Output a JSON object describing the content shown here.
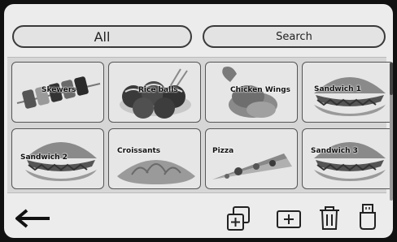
{
  "filter": {
    "all_label": "All",
    "search_label": "Search"
  },
  "items": [
    {
      "label": "Skewers",
      "icon": "skewers-image"
    },
    {
      "label": "Rice balls",
      "icon": "rice-balls-image"
    },
    {
      "label": "Chicken Wings",
      "icon": "chicken-wings-image"
    },
    {
      "label": "Sandwich 1",
      "icon": "sandwich-image"
    },
    {
      "label": "Sandwich 2",
      "icon": "sandwich-image"
    },
    {
      "label": "Croissants",
      "icon": "croissant-image"
    },
    {
      "label": "Pizza",
      "icon": "pizza-slice-image"
    },
    {
      "label": "Sandwich 3",
      "icon": "sandwich-image"
    }
  ],
  "toolbar": {
    "back": "back-arrow-icon",
    "add_folder": "add-folder-icon",
    "add": "add-icon",
    "delete": "trash-icon",
    "usb": "usb-drive-icon"
  }
}
